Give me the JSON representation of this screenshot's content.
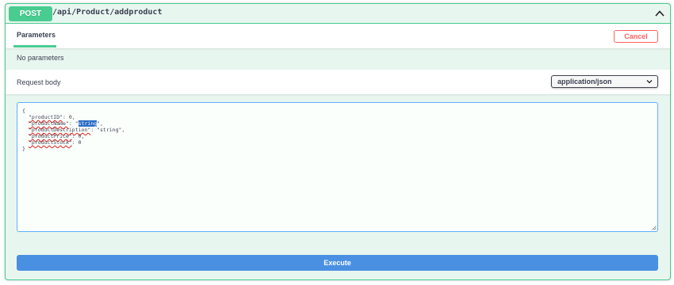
{
  "operation": {
    "method": "POST",
    "path": "/api/Product/addproduct"
  },
  "parameters": {
    "tab_label": "Parameters",
    "cancel_label": "Cancel",
    "empty_text": "No parameters"
  },
  "request_body": {
    "label": "Request body",
    "content_type": "application/json",
    "lines": {
      "open": "{",
      "l1_key": "\"productID\"",
      "l1_rest": ": 0,",
      "l2_key": "\"productName\"",
      "l2_mid": ": \"",
      "l2_sel": "string",
      "l2_rest": "\",",
      "l3_key": "\"productDescription\"",
      "l3_rest": ": \"string\",",
      "l4_key": "\"productPrice\"",
      "l4_rest": ": 0,",
      "l5_key": "\"productStock\"",
      "l5_rest": ": 0",
      "close": "}"
    }
  },
  "execute": {
    "label": "Execute"
  },
  "colors": {
    "post_accent": "#49cc90",
    "post_background": "#e8f6f0",
    "cancel_red": "#ff6060",
    "execute_blue": "#4990e2",
    "editor_border": "#61affe"
  },
  "icons": {
    "collapse": "chevron-up-icon",
    "select": "chevron-down-icon",
    "resize": "resize-grip-icon"
  }
}
